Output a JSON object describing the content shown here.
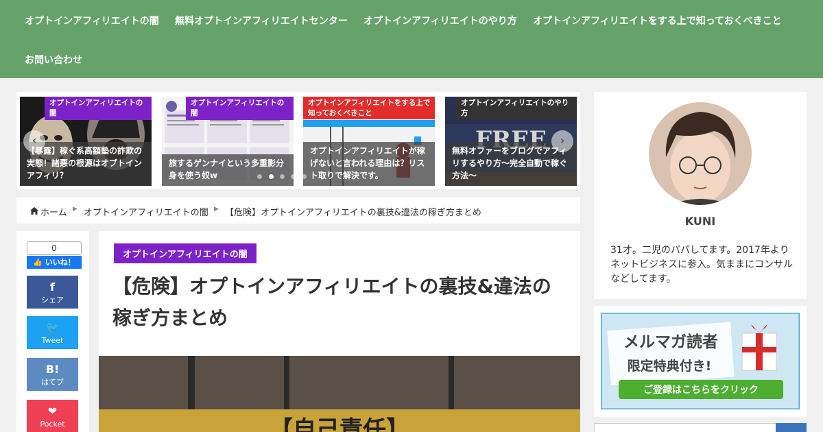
{
  "nav": {
    "items": [
      "オプトインアフィリエイトの闇",
      "無料オプトインアフィリエイトセンター",
      "オプトインアフィリエイトのやり方",
      "オプトインアフィリエイトをする上で知っておくべきこと",
      "お問い合わせ"
    ]
  },
  "carousel": {
    "prev_arrow": "‹",
    "next_arrow": "›",
    "slides": [
      {
        "category": "オプトインアフィリエイトの闇",
        "category_color": "#7d22c8",
        "title": "【暴露】稼ぐ系高額塾の詐欺の実態！諸悪の根源はオプトインアフィリ？"
      },
      {
        "category": "オプトインアフィリエイトの闇",
        "category_color": "#7d22c8",
        "title": "旅するゲンナイという多重影分身を使う奴w"
      },
      {
        "category": "オプトインアフィリエイトをする上で知っておくべきこと",
        "category_color": "#e22d2d",
        "title": "オプトインアフィリエイトが稼げないと言われる理由は？リスト取りで解決です。"
      },
      {
        "category": "オプトインアフィリエイトのやり方",
        "category_color": "#333333",
        "title": "無料オファーをブログでアフィリするやり方〜完全自動で稼ぐ方法〜",
        "image_text": "FREE"
      }
    ]
  },
  "breadcrumb": {
    "home_icon": "home-icon",
    "home": "ホーム",
    "category": "オプトインアフィリエイトの闇",
    "current": "【危険】オプトインアフィリエイトの裏技&違法の稼ぎ方まとめ"
  },
  "share": {
    "like_count": "0",
    "like_label": "👍 いいね！",
    "buttons": [
      {
        "icon": "f",
        "label": "シェア",
        "color": "#3b5998"
      },
      {
        "icon": "🐦",
        "label": "Tweet",
        "color": "#1da1f2"
      },
      {
        "icon": "B!",
        "label": "はてブ",
        "color": "#5d8ac1"
      },
      {
        "icon": "❤",
        "label": "Pocket",
        "color": "#ef4056"
      }
    ]
  },
  "article": {
    "category": "オプトインアフィリエイトの闇",
    "category_color": "#7d22c8",
    "title": "【危険】オプトインアフィリエイトの裏技&違法の稼ぎ方まとめ",
    "eyecatch_text": "【自己責任】"
  },
  "sidebar": {
    "profile": {
      "name": "KUNI",
      "description": "31才。二児のパパしてます。2017年よりネットビジネスに参入。気ままにコンサルなどしてます。"
    },
    "banner": {
      "line1": "メルマガ読者",
      "line2": "限定特典付き!",
      "cta": "ご登録はこちらをクリック"
    }
  },
  "colors": {
    "header_bg": "#66a36a",
    "accent_purple": "#7d22c8"
  }
}
